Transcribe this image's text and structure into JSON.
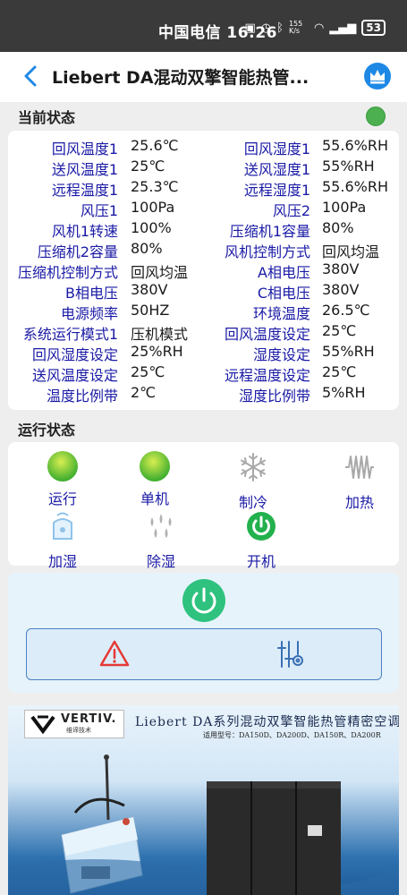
{
  "status_bar": {
    "carrier": "中国电信",
    "time": "16:26",
    "net_speed": "155 K/s",
    "battery": "53"
  },
  "app_bar": {
    "title": "Liebert DA混动双擎智能热管..."
  },
  "current_status": {
    "section_title": "当前状态",
    "online_color": "#4caf50",
    "params": [
      {
        "label": "回风温度1",
        "value": "25.6℃",
        "label2": "回风湿度1",
        "value2": "55.6%RH"
      },
      {
        "label": "送风温度1",
        "value": "25℃",
        "label2": "送风湿度1",
        "value2": "55%RH"
      },
      {
        "label": "远程温度1",
        "value": "25.3℃",
        "label2": "远程湿度1",
        "value2": "55.6%RH"
      },
      {
        "label": "风压1",
        "value": "100Pa",
        "label2": "风压2",
        "value2": "100Pa"
      },
      {
        "label": "风机1转速",
        "value": "100%",
        "label2": "压缩机1容量",
        "value2": "80%"
      },
      {
        "label": "压缩机2容量",
        "value": "80%",
        "label2": "风机控制方式",
        "value2": "回风均温"
      },
      {
        "label": "压缩机控制方式",
        "value": "回风均温",
        "label2": "A相电压",
        "value2": "380V"
      },
      {
        "label": "B相电压",
        "value": "380V",
        "label2": "C相电压",
        "value2": "380V"
      },
      {
        "label": "电源频率",
        "value": "50HZ",
        "label2": "环境温度",
        "value2": "26.5℃"
      },
      {
        "label": "系统运行模式1",
        "value": "压机模式",
        "label2": "回风温度设定",
        "value2": "25℃"
      },
      {
        "label": "回风湿度设定",
        "value": "25%RH",
        "label2": "湿度设定",
        "value2": "55%RH"
      },
      {
        "label": "送风温度设定",
        "value": "25℃",
        "label2": "远程温度设定",
        "value2": "25℃"
      },
      {
        "label": "温度比例带",
        "value": "2℃",
        "label2": "湿度比例带",
        "value2": "5%RH"
      }
    ]
  },
  "run_status": {
    "section_title": "运行状态",
    "items": [
      {
        "label": "运行",
        "icon": "green-ball-icon"
      },
      {
        "label": "单机",
        "icon": "green-ball-icon"
      },
      {
        "label": "制冷",
        "icon": "snowflake-icon"
      },
      {
        "label": "加热",
        "icon": "heater-icon"
      },
      {
        "label": "加湿",
        "icon": "humidifier-icon"
      },
      {
        "label": "除湿",
        "icon": "droplets-icon"
      },
      {
        "label": "开机",
        "icon": "power-on-icon"
      }
    ]
  },
  "controls": {
    "power_color": "#2ec27e",
    "alarm_color": "#e53935",
    "settings_color": "#3a6fb5"
  },
  "banner": {
    "brand": "VERTIV.",
    "brand_sub": "维谛技术",
    "title": "Liebert DA系列混动双擎智能热管精密空调",
    "models": "适用型号：DA150D、DA200D、DA150R、DA200R"
  }
}
